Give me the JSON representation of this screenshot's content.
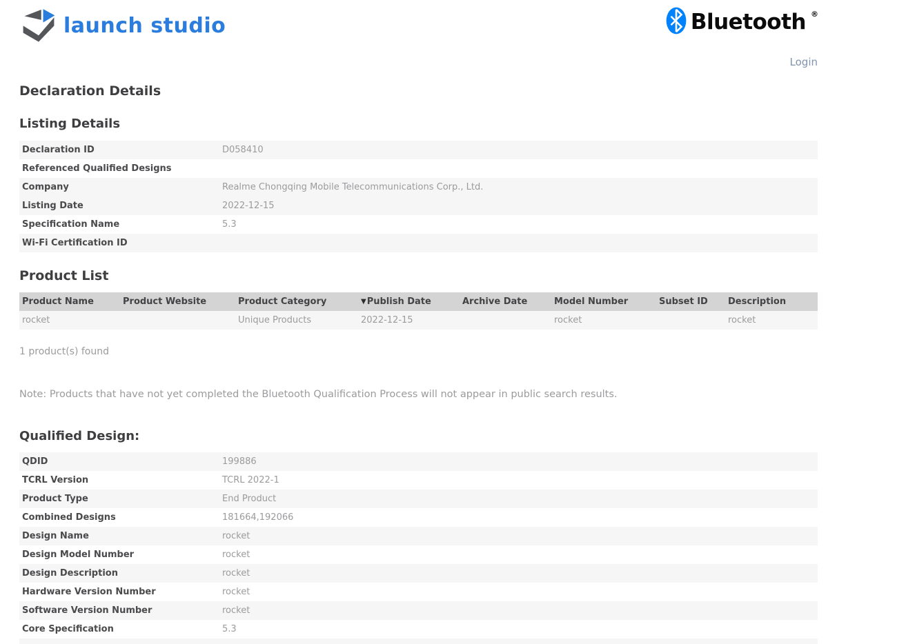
{
  "header": {
    "logo_text": "launch studio",
    "bluetooth_word": "Bluetooth",
    "bluetooth_reg": "®",
    "login_label": "Login"
  },
  "colors": {
    "brand_blue": "#2b7ddd",
    "bluetooth_blue": "#0082fc",
    "heading_gray": "#3e3e40",
    "value_gray": "#9b9b9d",
    "table_header_bg": "#d4d4d4",
    "stripe_bg": "#f6f6f7",
    "login_link": "#8094ad"
  },
  "page": {
    "title": "Declaration Details"
  },
  "listing_details": {
    "heading": "Listing Details",
    "rows": [
      {
        "label": "Declaration ID",
        "value": "D058410"
      },
      {
        "label": "Referenced Qualified Designs",
        "value": ""
      },
      {
        "label": "Company",
        "value": "Realme Chongqing Mobile Telecommunications Corp., Ltd."
      },
      {
        "label": "Listing Date",
        "value": "2022-12-15"
      },
      {
        "label": "Specification Name",
        "value": "5.3"
      },
      {
        "label": "Wi-Fi Certification ID",
        "value": ""
      }
    ]
  },
  "product_list": {
    "heading": "Product List",
    "columns": [
      "Product Name",
      "Product Website",
      "Product Category",
      "Publish Date",
      "Archive Date",
      "Model Number",
      "Subset ID",
      "Description"
    ],
    "sort": {
      "column": "Publish Date",
      "direction": "descending",
      "caret": "▼"
    },
    "rows": [
      {
        "product_name": "rocket",
        "product_website": "",
        "product_category": "Unique Products",
        "publish_date": "2022-12-15",
        "archive_date": "",
        "model_number": "rocket",
        "subset_id": "",
        "description": "rocket"
      }
    ],
    "result_count_text": "1 product(s) found",
    "note": "Note: Products that have not yet completed the Bluetooth Qualification Process will not appear in public search results."
  },
  "qualified_design": {
    "heading": "Qualified Design:",
    "rows": [
      {
        "label": "QDID",
        "value": "199886"
      },
      {
        "label": "TCRL Version",
        "value": "TCRL 2022-1"
      },
      {
        "label": "Product Type",
        "value": "End Product"
      },
      {
        "label": "Combined Designs",
        "value": "181664,192066"
      },
      {
        "label": "Design Name",
        "value": "rocket"
      },
      {
        "label": "Design Model Number",
        "value": "rocket"
      },
      {
        "label": "Design Description",
        "value": "rocket"
      },
      {
        "label": "Hardware Version Number",
        "value": "rocket"
      },
      {
        "label": "Software Version Number",
        "value": "rocket"
      },
      {
        "label": "Core Specification",
        "value": "5.3"
      }
    ]
  }
}
